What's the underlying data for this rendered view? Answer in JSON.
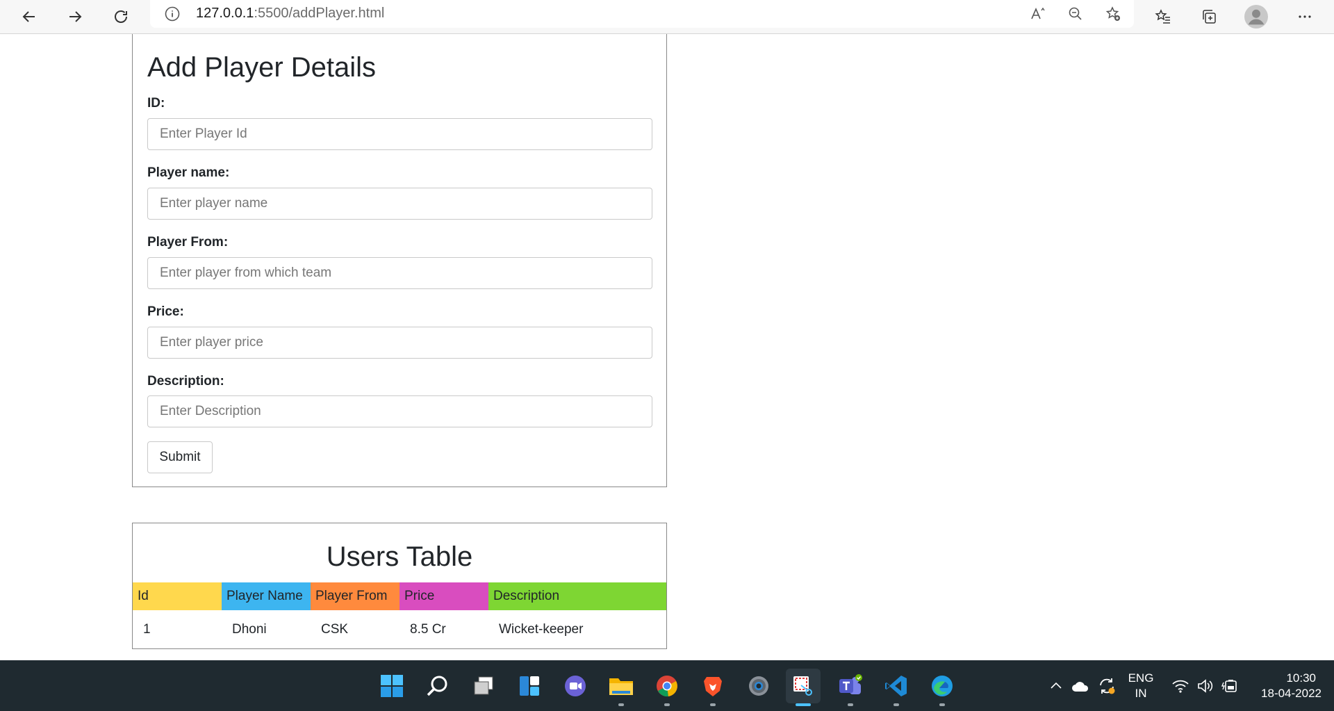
{
  "browser": {
    "url_host": "127.0.0.1",
    "url_rest": ":5500/addPlayer.html"
  },
  "form": {
    "title": "Add Player Details",
    "fields": [
      {
        "label": "ID:",
        "placeholder": "Enter Player Id"
      },
      {
        "label": "Player name:",
        "placeholder": "Enter player name"
      },
      {
        "label": "Player From:",
        "placeholder": "Enter player from which team"
      },
      {
        "label": "Price:",
        "placeholder": "Enter player price"
      },
      {
        "label": "Description:",
        "placeholder": "Enter Description"
      }
    ],
    "submit_label": "Submit"
  },
  "table": {
    "title": "Users Table",
    "headers": [
      {
        "label": "Id",
        "color": "#ffd84d"
      },
      {
        "label": "Player Name",
        "color": "#3db5f0"
      },
      {
        "label": "Player From",
        "color": "#ff8a3d"
      },
      {
        "label": "Price",
        "color": "#d94dbf"
      },
      {
        "label": "Description",
        "color": "#7ed633"
      }
    ],
    "rows": [
      [
        "1",
        "Dhoni",
        "CSK",
        "8.5 Cr",
        "Wicket-keeper"
      ]
    ]
  },
  "taskbar": {
    "lang_top": "ENG",
    "lang_bottom": "IN",
    "time": "10:30",
    "date": "18-04-2022"
  }
}
